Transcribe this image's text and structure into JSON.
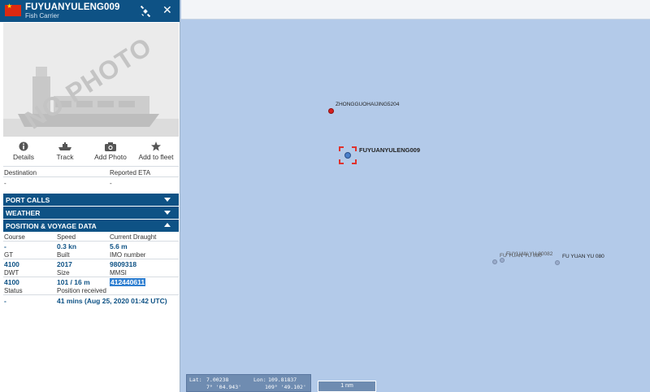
{
  "header": {
    "vessel_name": "FUYUANYULENG009",
    "vessel_type": "Fish Carrier"
  },
  "photo": {
    "placeholder": "NO PHOTO"
  },
  "actions": [
    {
      "label": "Details"
    },
    {
      "label": "Track"
    },
    {
      "label": "Add Photo"
    },
    {
      "label": "Add to fleet"
    }
  ],
  "destination": {
    "label": "Destination",
    "value": "-"
  },
  "eta": {
    "label": "Reported ETA",
    "value": "-"
  },
  "sections": {
    "port_calls": "PORT CALLS",
    "weather": "WEATHER",
    "position": "POSITION & VOYAGE DATA"
  },
  "voyage": {
    "course_label": "Course",
    "course": "-",
    "speed_label": "Speed",
    "speed": "0.3 kn",
    "draught_label": "Current Draught",
    "draught": "5.6 m",
    "gt_label": "GT",
    "gt": "4100",
    "built_label": "Built",
    "built": "2017",
    "imo_label": "IMO number",
    "imo": "9809318",
    "dwt_label": "DWT",
    "dwt": "4100",
    "size_label": "Size",
    "size": "101 / 16 m",
    "mmsi_label": "MMSI",
    "mmsi": "412440611",
    "status_label": "Status",
    "status": "-",
    "received_label": "Position received",
    "received": "41 mins (Aug 25, 2020 01:42 UTC)"
  },
  "map": {
    "ships": [
      {
        "label": "ZHONGGUOHAIJING5204",
        "color": "#d62020"
      },
      {
        "label": "FUYUANYULENG009",
        "color": "#4a7fc9"
      },
      {
        "label": "FUYUAN YU 80082"
      },
      {
        "label": "FU YUAN YU 080"
      },
      {
        "label": "FU YUAN YU 080"
      }
    ],
    "coords": {
      "lat_label": "Lat:",
      "lat": "7.00238",
      "lon_label": "Lon:",
      "lon": "109.81837",
      "lat_dms": "7° '04.943'",
      "lon_dms": "109° '49.102'"
    },
    "scale": "1 nm"
  },
  "colors": {
    "header": "#0e5285",
    "map_water": "#b3cae9",
    "highlight": "#e0322c"
  }
}
